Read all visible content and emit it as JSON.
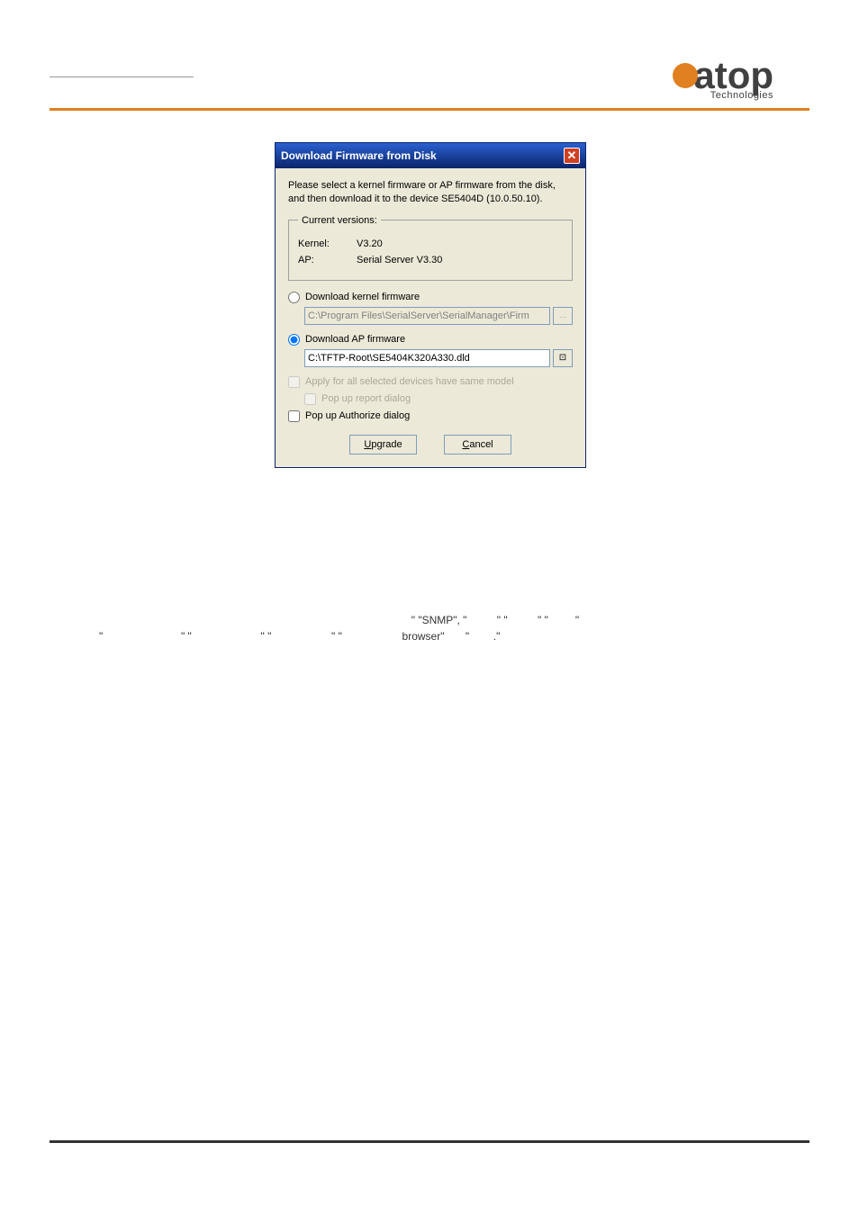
{
  "header": {
    "logo_text": "atop",
    "logo_sub": "Technologies"
  },
  "dialog": {
    "title": "Download Firmware from Disk",
    "instruction": "Please select a kernel firmware or AP firmware from the disk, and then download it to the device SE5404D (10.0.50.10).",
    "versions_legend": "Current versions:",
    "kernel_label": "Kernel:",
    "kernel_value": "V3.20",
    "ap_label": "AP:",
    "ap_value": "Serial Server V3.30",
    "radio_kernel": "Download kernel firmware",
    "kernel_path": "C:\\Program Files\\SerialServer\\SerialManager\\Firm",
    "radio_ap": "Download AP firmware",
    "ap_path": "C:\\TFTP-Root\\SE5404K320A330.dld",
    "chk_apply_all": "Apply for all selected devices have same model",
    "chk_popup_report": "Pop up report dialog",
    "chk_popup_auth": "Pop up Authorize dialog",
    "btn_upgrade": "pgrade",
    "btn_cancel": "ancel"
  },
  "body": {
    "text_pre": "",
    "snmp": "\"SNMP\"",
    "browser": "browser\""
  }
}
